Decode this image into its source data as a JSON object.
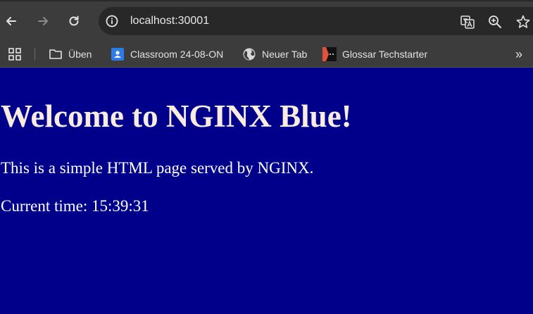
{
  "browser": {
    "address": "localhost:30001",
    "icons": [
      "back-icon",
      "forward-icon",
      "reload-icon",
      "info-icon",
      "translate-icon",
      "zoom-icon",
      "star-icon",
      "apps-grid-icon",
      "folder-icon",
      "classroom-icon",
      "globe-icon",
      "glossar-icon",
      "chevron-double-right-icon"
    ]
  },
  "bookmarks": {
    "items": [
      {
        "label": "Üben"
      },
      {
        "label": "Classroom 24-08-ON"
      },
      {
        "label": "Neuer Tab"
      },
      {
        "label": "Glossar Techstarter"
      }
    ],
    "more": "»"
  },
  "page": {
    "heading": "Welcome to NGINX Blue!",
    "paragraph": "This is a simple HTML page served by NGINX.",
    "time_text": "Current time: 15:39:31"
  },
  "colors": {
    "background": "#00008b",
    "heading": "#f8ebe0",
    "text": "#ffffff",
    "toolbar": "#3c3c3c",
    "omnibox": "#282828"
  }
}
